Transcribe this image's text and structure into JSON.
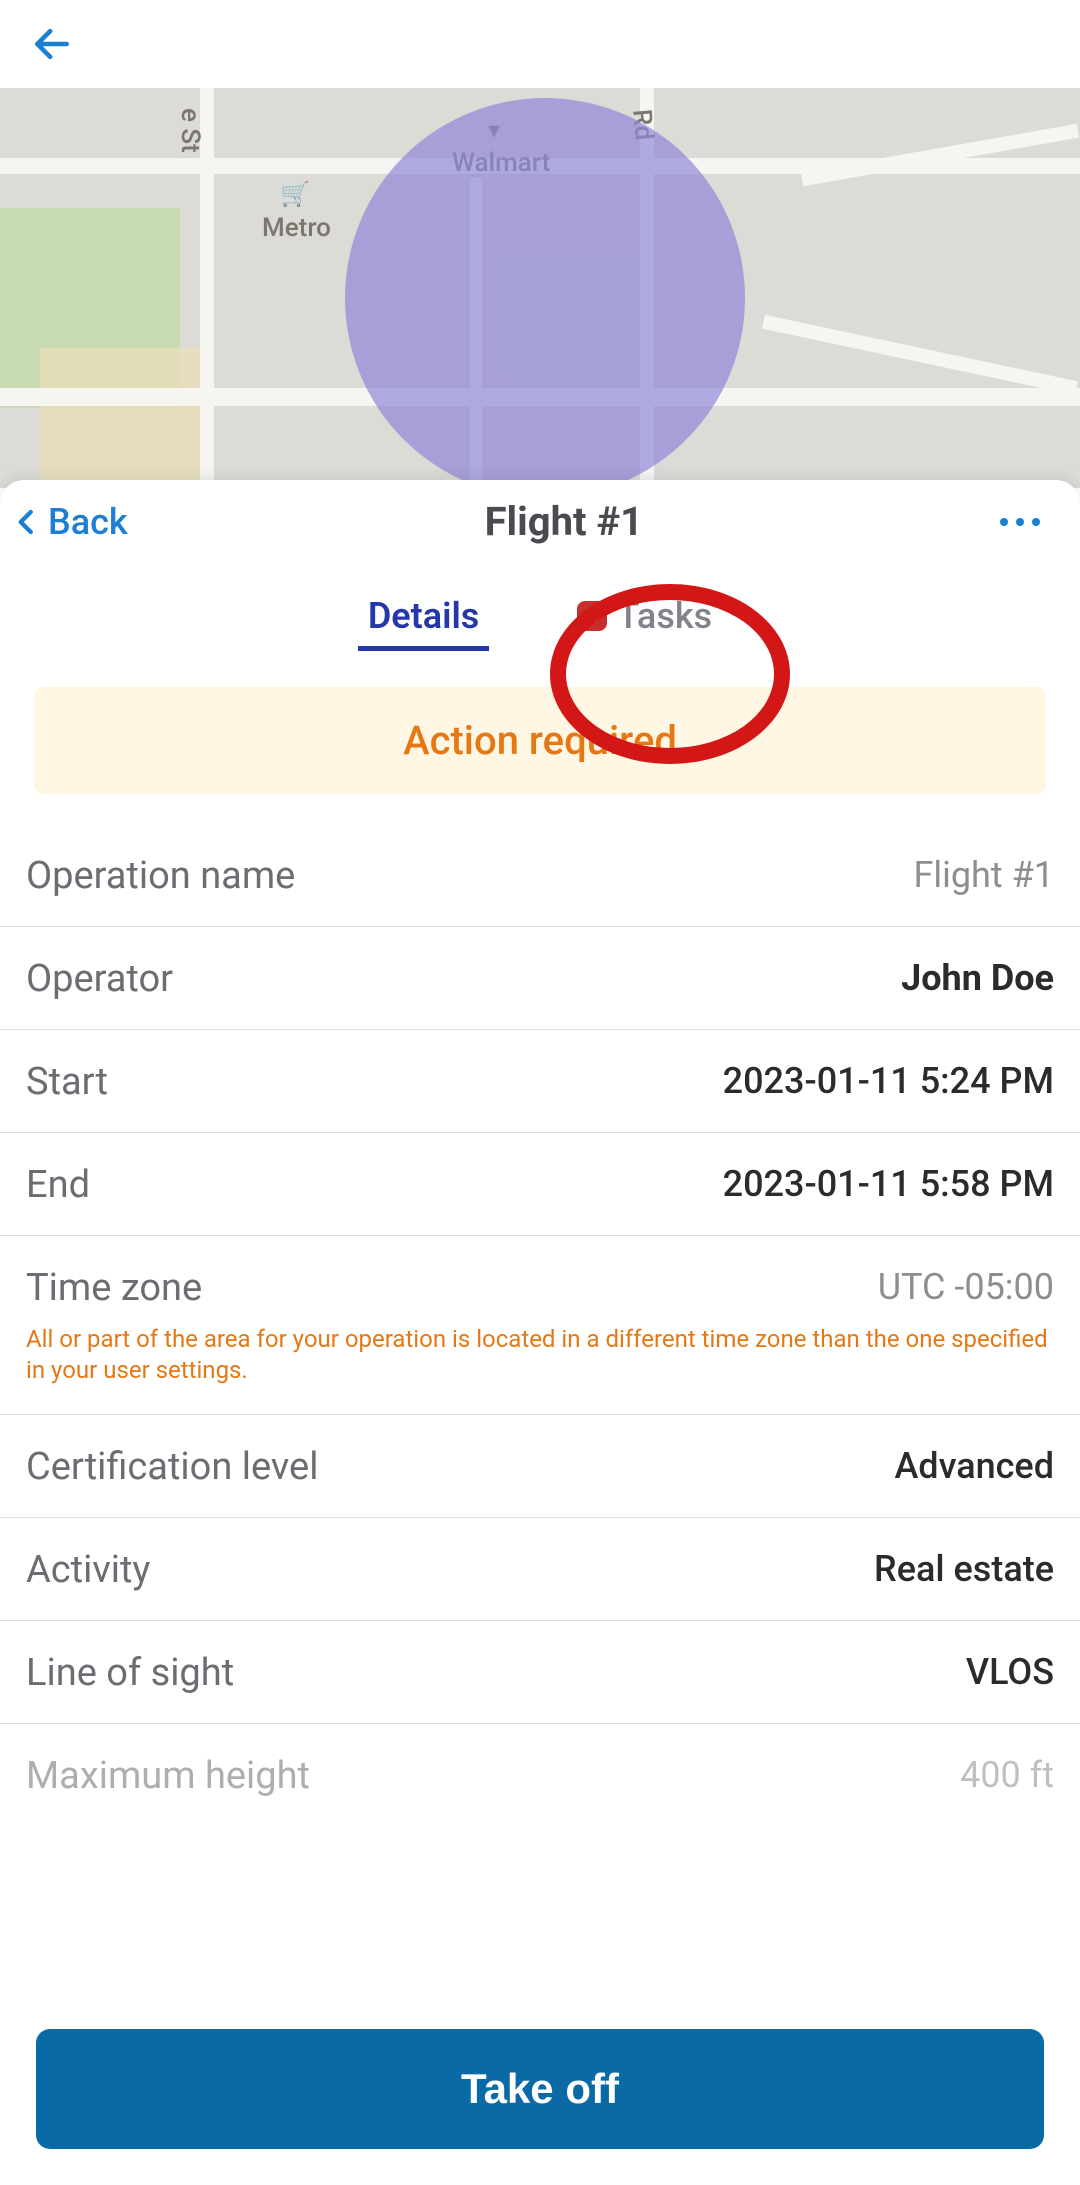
{
  "header": {
    "back_label": "Back",
    "title": "Flight #1"
  },
  "tabs": {
    "details": "Details",
    "tasks": "Tasks",
    "tasks_badge": "2"
  },
  "alert": "Action required",
  "map": {
    "label_walmart": "Walmart",
    "label_metro": "Metro",
    "street_e": "e St",
    "street_rd": "Rd"
  },
  "details": {
    "operation_name_label": "Operation name",
    "operation_name_value": "Flight #1",
    "operator_label": "Operator",
    "operator_value": "John Doe",
    "start_label": "Start",
    "start_value": "2023-01-11 5:24 PM",
    "end_label": "End",
    "end_value": "2023-01-11 5:58 PM",
    "tz_label": "Time zone",
    "tz_value": "UTC -05:00",
    "tz_note": "All or part of the area for your operation is located in a different time zone than the one specified in your user settings.",
    "cert_label": "Certification level",
    "cert_value": "Advanced",
    "activity_label": "Activity",
    "activity_value": "Real estate",
    "los_label": "Line of sight",
    "los_value": "VLOS",
    "max_height_label": "Maximum height",
    "max_height_value": "400 ft"
  },
  "footer": {
    "primary": "Take off"
  }
}
